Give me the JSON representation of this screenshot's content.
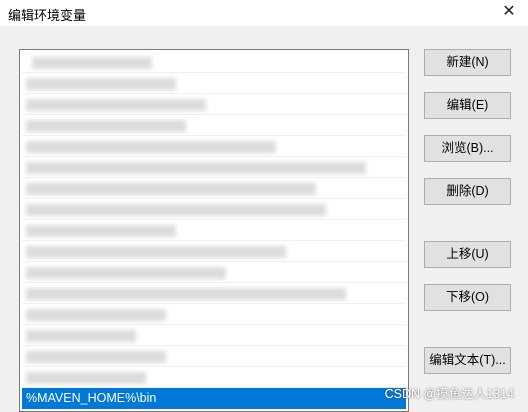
{
  "window": {
    "title": "编辑环境变量",
    "close_label": "✕"
  },
  "list": {
    "selected_value": "%MAVEN_HOME%\\bin"
  },
  "buttons": {
    "new": "新建(N)",
    "edit": "编辑(E)",
    "browse": "浏览(B)...",
    "delete": "删除(D)",
    "move_up": "上移(U)",
    "move_down": "下移(O)",
    "edit_text": "编辑文本(T)..."
  },
  "watermark": "CSDN @摸鱼达人1314"
}
